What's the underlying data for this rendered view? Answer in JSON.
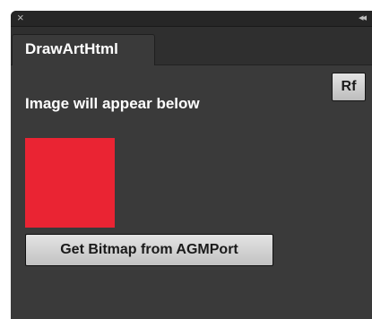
{
  "panel": {
    "tab_label": "DrawArtHtml"
  },
  "titlebar": {
    "close_icon": "close-icon",
    "collapse_icon": "double-chevron-left-icon"
  },
  "content": {
    "label": "Image will appear below",
    "refresh_button_label": "Rf",
    "bitmap_button_label": "Get Bitmap from AGMPort",
    "image_color": "#ea2433"
  },
  "colors": {
    "panel_background": "#3a3a3a",
    "titlebar_background": "#262626",
    "button_face": "#d4d4d4",
    "text": "#ffffff"
  }
}
